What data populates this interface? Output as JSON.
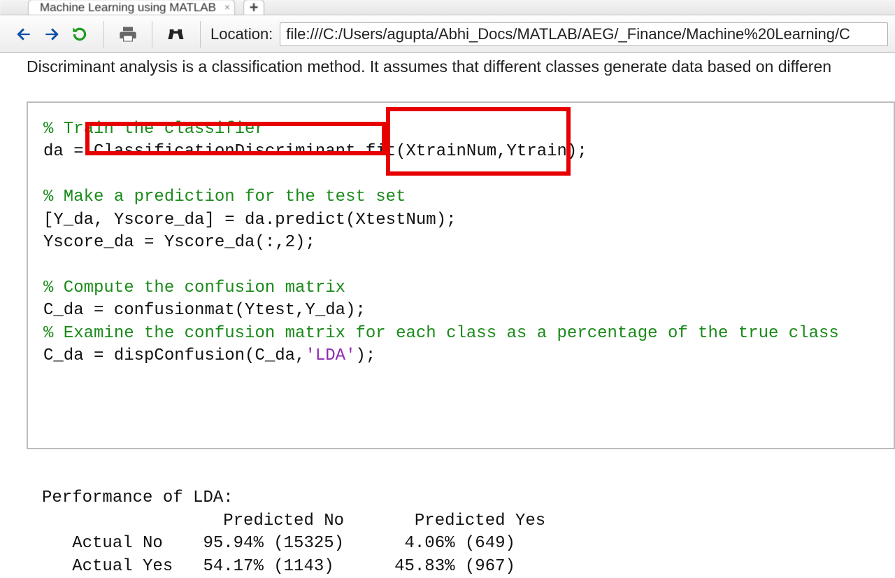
{
  "tab": {
    "title": "Machine Learning using MATLAB",
    "close_glyph": "×",
    "plus_glyph": "+"
  },
  "toolbar": {
    "location_label": "Location:",
    "location_value": "file:///C:/Users/agupta/Abhi_Docs/MATLAB/AEG/_Finance/Machine%20Learning/C"
  },
  "intro_text": "Discriminant analysis is a classification method. It assumes that different classes generate data based on differen",
  "code": {
    "c1": "% Train the classifier",
    "l1a": "da = ",
    "l1b": "ClassificationDiscriminant.fit",
    "l1c": "(XtrainNum,Ytrain)",
    "l1d": ";",
    "c2": "% Make a prediction for the test set",
    "l2": "[Y_da, Yscore_da] = da.predict(XtestNum);",
    "l3": "Yscore_da = Yscore_da(:,2);",
    "c3": "% Compute the confusion matrix",
    "l4": "C_da = confusionmat(Ytest,Y_da);",
    "c4": "% Examine the confusion matrix for each class as a percentage of the true class",
    "l5a": "C_da = dispConfusion(C_da,",
    "l5b": "'LDA'",
    "l5c": ");"
  },
  "output": {
    "title": "Performance of LDA:",
    "header": "                  Predicted No       Predicted Yes",
    "row1": "   Actual No    95.94% (15325)      4.06% (649)",
    "row2": "   Actual Yes   54.17% (1143)      45.83% (967)"
  },
  "chart_data": {
    "type": "table",
    "title": "Performance of LDA",
    "columns": [
      "",
      "Predicted No",
      "Predicted Yes"
    ],
    "rows": [
      {
        "label": "Actual No",
        "predicted_no_pct": 95.94,
        "predicted_no_count": 15325,
        "predicted_yes_pct": 4.06,
        "predicted_yes_count": 649
      },
      {
        "label": "Actual Yes",
        "predicted_no_pct": 54.17,
        "predicted_no_count": 1143,
        "predicted_yes_pct": 45.83,
        "predicted_yes_count": 967
      }
    ]
  }
}
